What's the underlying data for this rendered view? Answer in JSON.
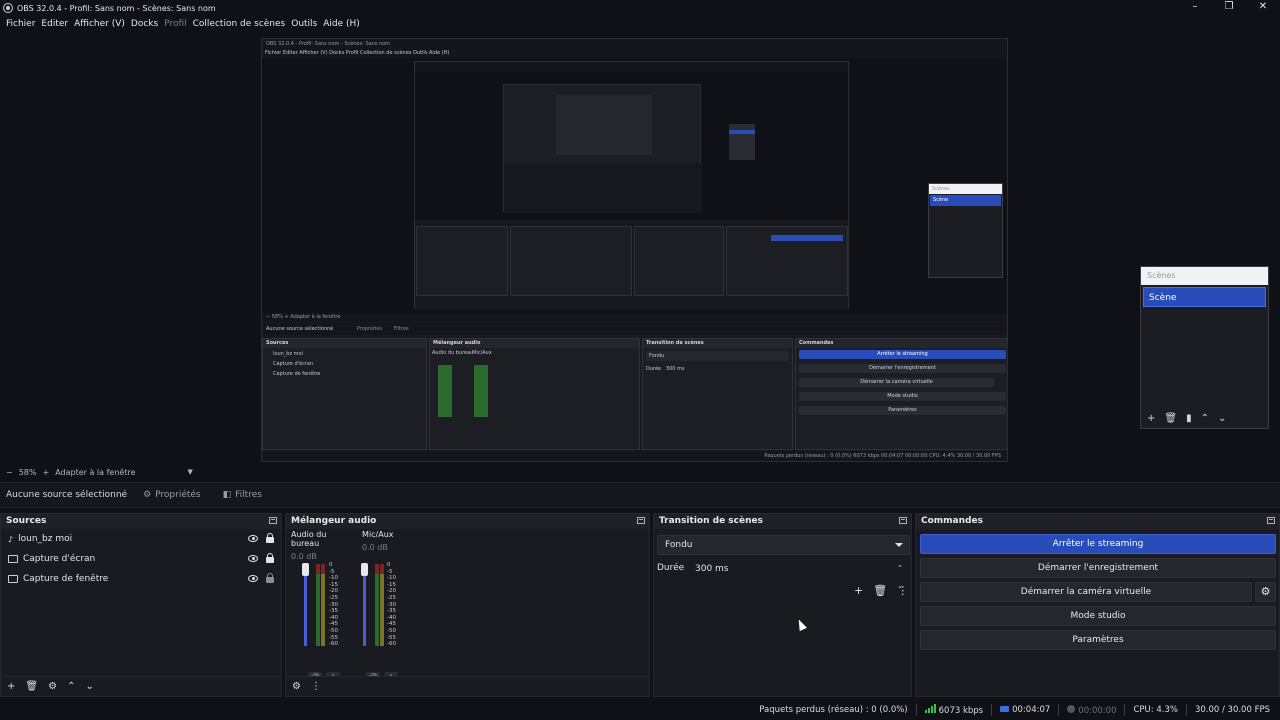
{
  "window": {
    "title": "OBS 32.0.4 - Profil: Sans nom - Scènes: Sans nom",
    "min": "–",
    "max": "❐",
    "close": "✕"
  },
  "menu": [
    "Fichier",
    "Editer",
    "Afficher (V)",
    "Docks",
    "Profil",
    "Collection de scènes",
    "Outils",
    "Aide (H)"
  ],
  "zoom": {
    "minus": "−",
    "value": "58%",
    "plus": "+",
    "fit": "Adapter à la fenêtre"
  },
  "context": {
    "no_source": "Aucune source sélectionné",
    "properties": "Propriétés",
    "filters": "Filtres"
  },
  "sources": {
    "title": "Sources",
    "items": [
      {
        "label": "loun_bz moi"
      },
      {
        "label": "Capture d'écran"
      },
      {
        "label": "Capture de fenêtre"
      }
    ]
  },
  "mixer": {
    "title": "Mélangeur audio",
    "channels": [
      {
        "name": "Audio du bureau",
        "db": "0.0 dB"
      },
      {
        "name": "Mic/Aux",
        "db": "0.0 dB"
      }
    ],
    "scale": [
      "0",
      "-5",
      "-10",
      "-15",
      "-20",
      "-25",
      "-30",
      "-35",
      "-40",
      "-45",
      "-50",
      "-55",
      "-60"
    ]
  },
  "transitions": {
    "title": "Transition de scènes",
    "type": "Fondu",
    "duration_label": "Durée",
    "duration_value": "300 ms"
  },
  "controls": {
    "title": "Commandes",
    "stop_stream": "Arrêter le streaming",
    "start_rec": "Démarrer l'enregistrement",
    "virtual_cam": "Démarrer la caméra virtuelle",
    "studio": "Mode studio",
    "settings": "Paramètres"
  },
  "scenes": {
    "title": "Scènes",
    "items": [
      "Scène"
    ]
  },
  "status": {
    "dropped": "Paquets perdus (réseau) : 0 (0.0%)",
    "bitrate": "6073 kbps",
    "stream_time": "00:04:07",
    "rec_time": "00:00:00",
    "cpu": "CPU: 4.3%",
    "fps": "30.00 / 30.00 FPS"
  },
  "nested": {
    "title": "OBS 32.0.4 - Profil: Sans nom - Scènes: Sans nom",
    "menu": "Fichier   Editer   Afficher (V)   Docks   Profil   Collection de scènes   Outils   Aide (H)",
    "zoom": "−  58%  +  Adapter à la fenêtre",
    "no_source": "Aucune source sélectionné",
    "properties": "Propriétés",
    "filters": "Filtres",
    "sources_title": "Sources",
    "src1": "loun_bz moi",
    "src2": "Capture d'écran",
    "src3": "Capture de fenêtre",
    "mixer_title": "Mélangeur audio",
    "ch1": "Audio du bureau",
    "ch2": "Mic/Aux",
    "trans_title": "Transition de scènes",
    "trans_type": "Fondu",
    "duration": "Durée",
    "duration_val": "300 ms",
    "ctrl_title": "Commandes",
    "stop": "Arrêter le streaming",
    "rec": "Démarrer l'enregistrement",
    "vcam": "Démarrer la caméra virtuelle",
    "studio": "Mode studio",
    "settings": "Paramètres",
    "status": "Paquets perdus (réseau) : 0 (0.0%)     6073 kbps     00:04:07     00:00:00     CPU: 4.4%     30.00 / 30.00 FPS",
    "scenes_title": "Scènes",
    "scene": "Scène"
  }
}
